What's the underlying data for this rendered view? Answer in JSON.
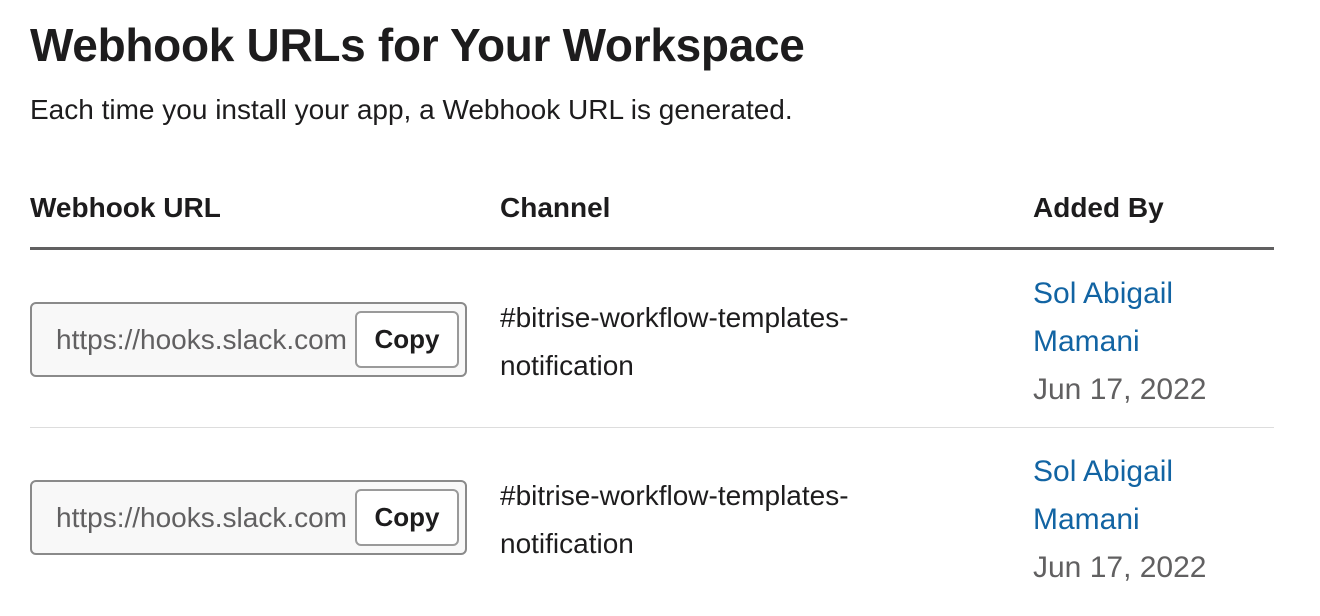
{
  "header": {
    "title": "Webhook URLs for Your Workspace",
    "subtitle": "Each time you install your app, a Webhook URL is generated."
  },
  "table": {
    "columns": [
      "Webhook URL",
      "Channel",
      "Added By"
    ],
    "rows": [
      {
        "url": "https://hooks.slack.com",
        "copy_label": "Copy",
        "channel": "#bitrise-workflow-templates-notification",
        "added_by": "Sol Abigail Mamani",
        "date": "Jun 17, 2022"
      },
      {
        "url": "https://hooks.slack.com",
        "copy_label": "Copy",
        "channel": "#bitrise-workflow-templates-notification",
        "added_by": "Sol Abigail Mamani",
        "date": "Jun 17, 2022"
      }
    ]
  },
  "colors": {
    "link": "#1264a3",
    "text": "#1d1c1d",
    "muted": "#616061"
  }
}
